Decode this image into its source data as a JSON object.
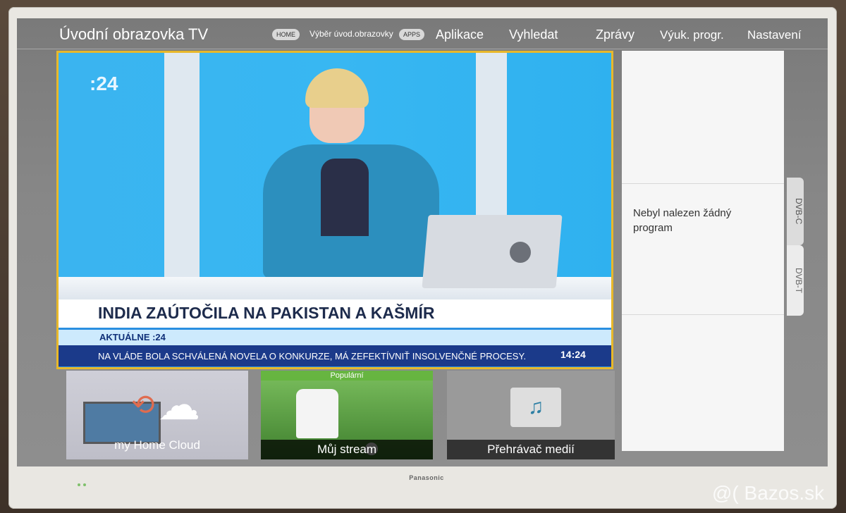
{
  "topbar": {
    "title": "Úvodní obrazovka TV",
    "home_badge": "HOME",
    "home_label": "Výběr úvod.obrazovky",
    "apps_badge": "APPS",
    "items": [
      "Aplikace",
      "Vyhledat",
      "Zprávy",
      "Výuk. progr.",
      "Nastavení"
    ]
  },
  "tv": {
    "channel_logo": ":24",
    "headline": "INDIA ZAÚTOČILA NA PAKISTAN A KAŠMÍR",
    "ticker_label": "AKTUÁLNE :24",
    "ticker": "NA VLÁDE BOLA SCHVÁLENÁ NOVELA O KONKURZE, MÁ ZEFEKTÍVNIŤ INSOLVENČNÉ PROCESY.",
    "time": "14:24"
  },
  "right_panel": {
    "message": "Nebyl nalezen žádný program",
    "tabs": [
      "DVB-C",
      "DVB-T"
    ]
  },
  "tiles": [
    {
      "label": "my Home Cloud",
      "icon": "cloud-icon"
    },
    {
      "label": "Můj stream",
      "badge": "Populární",
      "icon": "soccer-icon"
    },
    {
      "label": "Přehrávač medií",
      "icon": "media-player-icon"
    }
  ],
  "device": {
    "brand": "Panasonic"
  },
  "watermark": "@( Bazos.sk"
}
